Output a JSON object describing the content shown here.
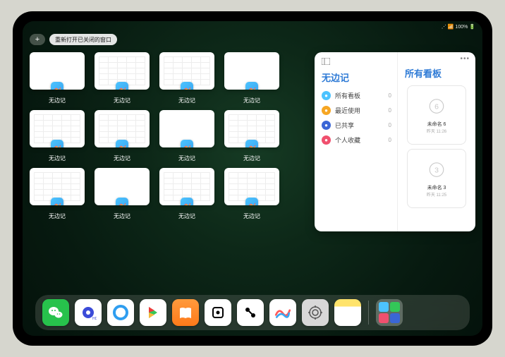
{
  "status": {
    "right": "⋰ 📶 100% 🔋"
  },
  "top": {
    "reopen_label": "重新打开已关闭的窗口"
  },
  "app_name": "无边记",
  "thumbs": [
    {
      "variant": "blank"
    },
    {
      "variant": "grid"
    },
    {
      "variant": "grid"
    },
    {
      "variant": "blank"
    },
    {
      "variant": "grid"
    },
    {
      "variant": "grid"
    },
    {
      "variant": "blank"
    },
    {
      "variant": "grid"
    },
    {
      "variant": "grid"
    },
    {
      "variant": "blank"
    },
    {
      "variant": "grid"
    },
    {
      "variant": "grid"
    }
  ],
  "panel": {
    "title_left": "无边记",
    "title_right": "所有看板",
    "items": [
      {
        "icon_color": "#4cc3ff",
        "label": "所有看板",
        "count": "0"
      },
      {
        "icon_color": "#f6a623",
        "label": "最近使用",
        "count": "0"
      },
      {
        "icon_color": "#3a66d6",
        "label": "已共享",
        "count": "0"
      },
      {
        "icon_color": "#f0506e",
        "label": "个人收藏",
        "count": "0"
      }
    ],
    "boards": [
      {
        "name": "未命名 6",
        "sub": "昨天 11:26",
        "doodle": "6"
      },
      {
        "name": "未命名 3",
        "sub": "昨天 11:25",
        "doodle": "3"
      }
    ]
  },
  "dock": [
    {
      "name": "wechat",
      "bg": "#27c24c"
    },
    {
      "name": "quark",
      "bg": "#ffffff"
    },
    {
      "name": "qqbrowser",
      "bg": "#ffffff"
    },
    {
      "name": "play",
      "bg": "#ffffff"
    },
    {
      "name": "books",
      "bg": "linear-gradient(#ff9a3d,#ff7a1a)"
    },
    {
      "name": "dice",
      "bg": "#ffffff"
    },
    {
      "name": "connect",
      "bg": "#ffffff"
    },
    {
      "name": "freeform",
      "bg": "#ffffff"
    },
    {
      "name": "settings",
      "bg": "#d8d8d8"
    },
    {
      "name": "notes",
      "bg": "linear-gradient(#ffe36b 28%,#ffffff 28%)"
    }
  ]
}
